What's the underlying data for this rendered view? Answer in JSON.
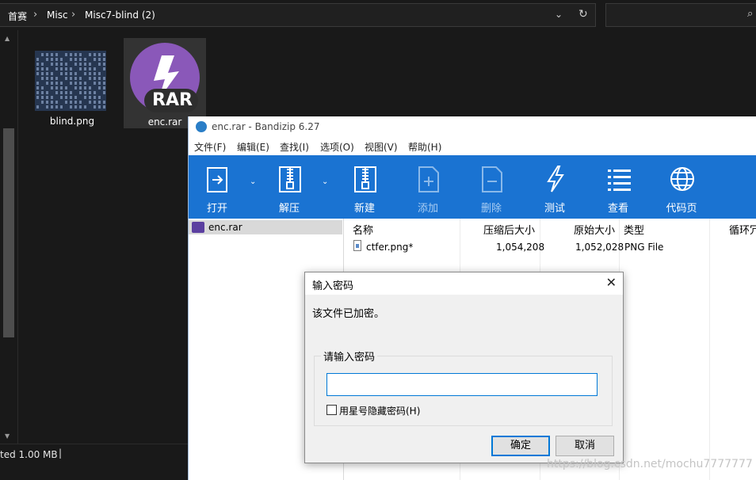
{
  "explorer": {
    "breadcrumb": [
      "首赛",
      "Misc",
      "Misc7-blind (2)"
    ],
    "separator": "›",
    "files": [
      {
        "name": "blind.png",
        "icon": "image-thumbnail"
      },
      {
        "name": "enc.rar",
        "icon": "bandizip-rar-icon",
        "badge": "RAR"
      }
    ],
    "status": "ted  1.00 MB"
  },
  "bandizip": {
    "title": "enc.rar - Bandizip 6.27",
    "menu": [
      "文件(F)",
      "编辑(E)",
      "查找(I)",
      "选项(O)",
      "视图(V)",
      "帮助(H)"
    ],
    "toolbar": [
      {
        "label": "打开",
        "icon": "open-icon"
      },
      {
        "label": "解压",
        "icon": "extract-icon"
      },
      {
        "label": "新建",
        "icon": "new-archive-icon"
      },
      {
        "label": "添加",
        "icon": "add-icon"
      },
      {
        "label": "删除",
        "icon": "delete-icon"
      },
      {
        "label": "测试",
        "icon": "test-icon"
      },
      {
        "label": "查看",
        "icon": "view-icon"
      },
      {
        "label": "代码页",
        "icon": "globe-icon"
      }
    ],
    "tree": {
      "root": "enc.rar"
    },
    "columns": [
      "名称",
      "压缩后大小",
      "原始大小",
      "类型",
      "循环冗"
    ],
    "rows": [
      {
        "name": "ctfer.png*",
        "packed": "1,054,208",
        "size": "1,052,028",
        "type": "PNG File"
      }
    ]
  },
  "dialog": {
    "title": "输入密码",
    "message": "该文件已加密。",
    "group_label": "请输入密码",
    "password_value": "",
    "hide_label": "用星号隐藏密码(H)",
    "ok_label": "确定",
    "cancel_label": "取消"
  },
  "watermark": "https://blog.csdn.net/mochu7777777"
}
